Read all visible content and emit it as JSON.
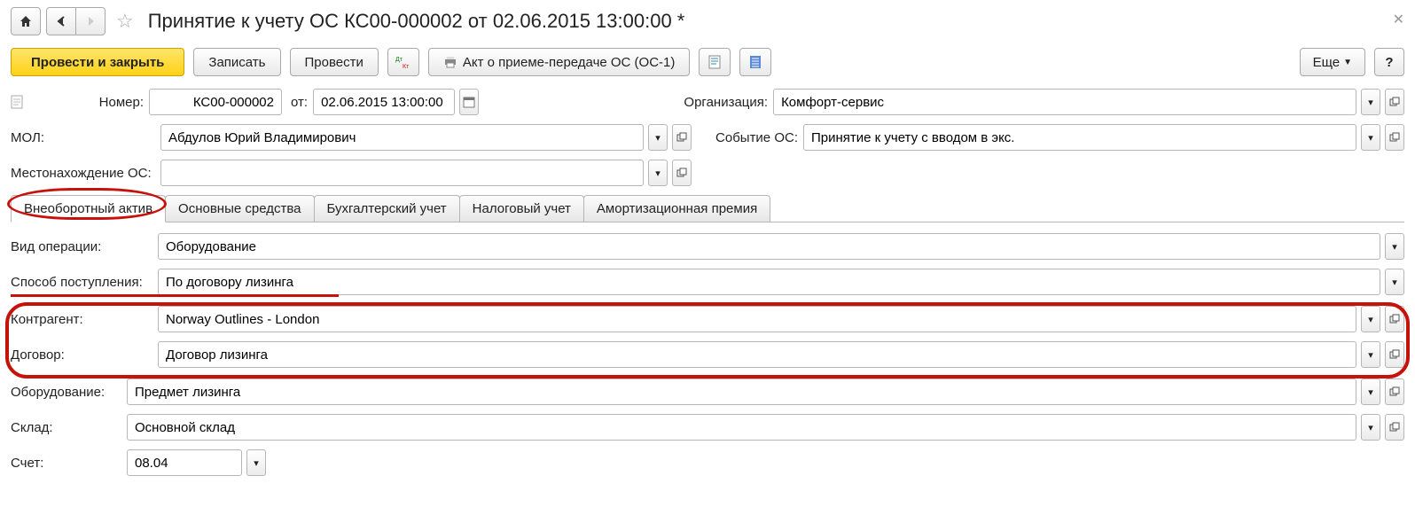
{
  "page_title": "Принятие к учету ОС КС00-000002 от 02.06.2015 13:00:00 *",
  "toolbar": {
    "post_close": "Провести и закрыть",
    "write": "Записать",
    "post": "Провести",
    "print": "Акт о приеме-передаче ОС (ОС-1)",
    "more": "Еще"
  },
  "fields": {
    "number_lbl": "Номер:",
    "number_val": "КС00-000002",
    "date_lbl": "от:",
    "date_val": "02.06.2015 13:00:00",
    "org_lbl": "Организация:",
    "org_val": "Комфорт-сервис",
    "mol_lbl": "МОЛ:",
    "mol_val": "Абдулов Юрий Владимирович",
    "event_lbl": "Событие ОС:",
    "event_val": "Принятие к учету с вводом в экс.",
    "loc_lbl": "Местонахождение ОС:",
    "loc_val": ""
  },
  "tabs": [
    "Внеоборотный актив",
    "Основные средства",
    "Бухгалтерский учет",
    "Налоговый учет",
    "Амортизационная премия"
  ],
  "active_tab": 0,
  "form": {
    "op_type_lbl": "Вид операции:",
    "op_type_val": "Оборудование",
    "receipt_lbl": "Способ поступления:",
    "receipt_val": "По договору лизинга",
    "contractor_lbl": "Контрагент:",
    "contractor_val": "Norway Outlines - London",
    "contract_lbl": "Договор:",
    "contract_val": "Договор лизинга",
    "equip_lbl": "Оборудование:",
    "equip_val": "Предмет лизинга",
    "store_lbl": "Склад:",
    "store_val": "Основной склад",
    "account_lbl": "Счет:",
    "account_val": "08.04"
  }
}
